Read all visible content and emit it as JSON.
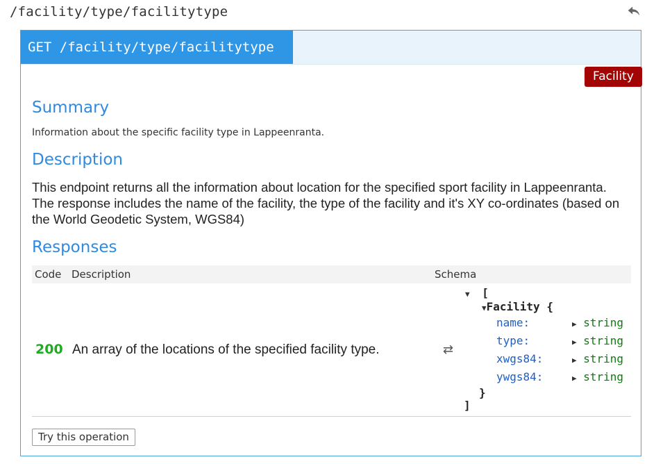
{
  "header": {
    "path": "/facility/type/facilitytype",
    "back_icon": "reply-arrow-icon"
  },
  "operation": {
    "method": "GET",
    "path": "/facility/type/facilitytype",
    "tag": "Facility",
    "colors": {
      "method_bg": "#2f96e6",
      "tag_bg": "#a30505",
      "heading": "#2f8ae0",
      "success_code": "#22aa22"
    }
  },
  "summary": {
    "heading": "Summary",
    "text": "Information about the specific facility type in Lappeenranta."
  },
  "description": {
    "heading": "Description",
    "text": "This endpoint returns all the information about location for the specified sport facility in Lappeenranta. The response includes the name of the facility, the type of the facility and it's XY co-ordinates (based on the World Geodetic System, WGS84)"
  },
  "responses": {
    "heading": "Responses",
    "columns": {
      "code": "Code",
      "description": "Description",
      "schema": "Schema"
    },
    "rows": [
      {
        "code": "200",
        "description": "An array of the locations of the specified facility type."
      }
    ],
    "schema": {
      "open_array": "[",
      "model_name": "Facility",
      "open_obj": "{",
      "fields": [
        {
          "name": "name:",
          "type": "string"
        },
        {
          "name": "type:",
          "type": "string"
        },
        {
          "name": "xwgs84:",
          "type": "string"
        },
        {
          "name": "ywgs84:",
          "type": "string"
        }
      ],
      "close_obj": "}",
      "close_array": "]"
    }
  },
  "actions": {
    "try_label": "Try this operation"
  }
}
